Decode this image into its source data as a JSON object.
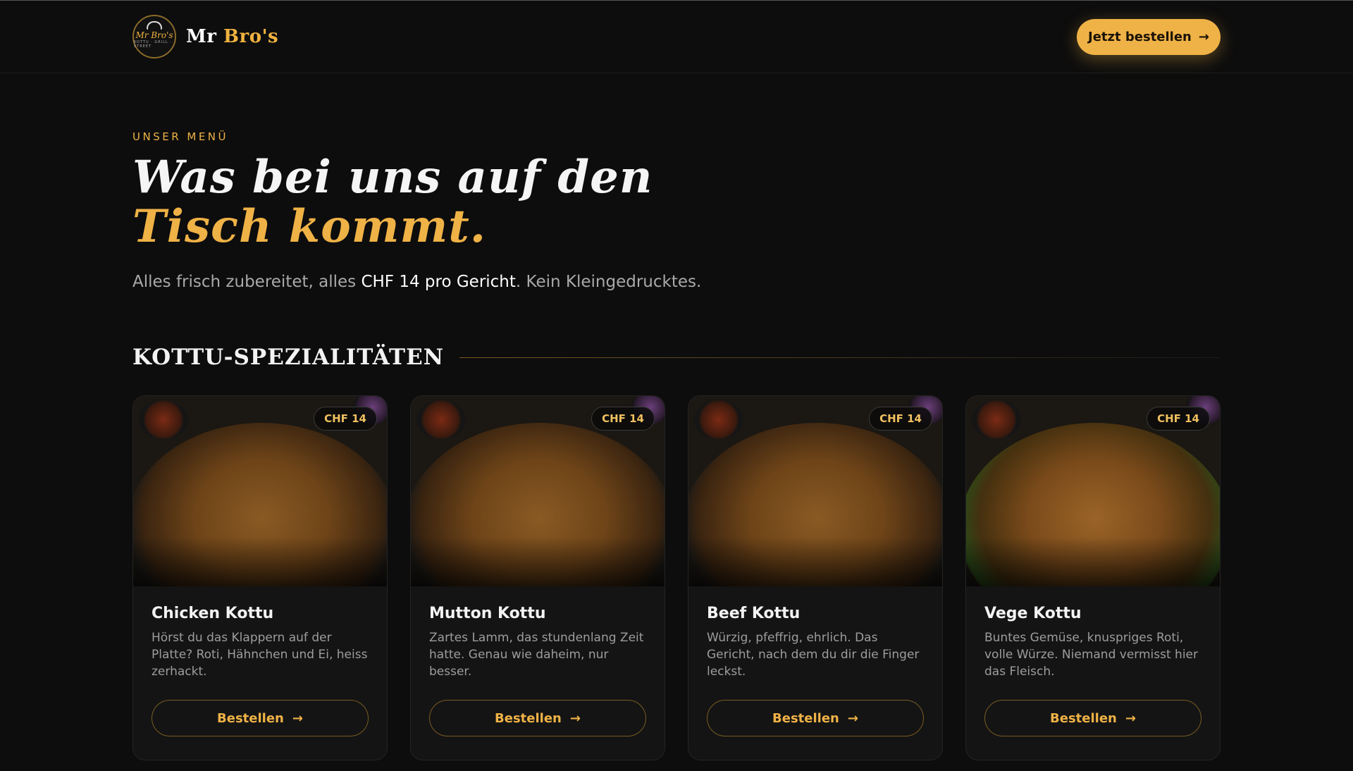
{
  "header": {
    "logo_text": "Mr Bro's",
    "logo_sub": "KOTTU · GRILL · STREET",
    "brand_first": "Mr",
    "brand_second": "Bro's",
    "cta_label": "Jetzt bestellen",
    "cta_icon": "arrow-right-icon"
  },
  "hero": {
    "eyebrow": "UNSER MENÜ",
    "title_plain": "Was bei uns auf den ",
    "title_highlight": "Tisch kommt.",
    "lead_before": "Alles frisch zubereitet, alles ",
    "lead_strong": "CHF 14 pro Gericht",
    "lead_after": ". Kein Kleingedrucktes."
  },
  "section": {
    "title": "KOTTU-SPEZIALITÄTEN"
  },
  "colors": {
    "accent": "#efb246",
    "background": "#0d0d0d",
    "card": "#141414"
  },
  "items": [
    {
      "name": "Chicken Kottu",
      "price": "CHF 14",
      "description": "Hörst du das Klappern auf der Platte? Roti, Hähnchen und Ei, heiss zerhackt.",
      "button": "Bestellen"
    },
    {
      "name": "Mutton Kottu",
      "price": "CHF 14",
      "description": "Zartes Lamm, das stundenlang Zeit hatte. Genau wie daheim, nur besser.",
      "button": "Bestellen"
    },
    {
      "name": "Beef Kottu",
      "price": "CHF 14",
      "description": "Würzig, pfeffrig, ehrlich. Das Gericht, nach dem du dir die Finger leckst.",
      "button": "Bestellen"
    },
    {
      "name": "Vege Kottu",
      "price": "CHF 14",
      "description": "Buntes Gemüse, knuspriges Roti, volle Würze. Niemand vermisst hier das Fleisch.",
      "button": "Bestellen"
    }
  ]
}
